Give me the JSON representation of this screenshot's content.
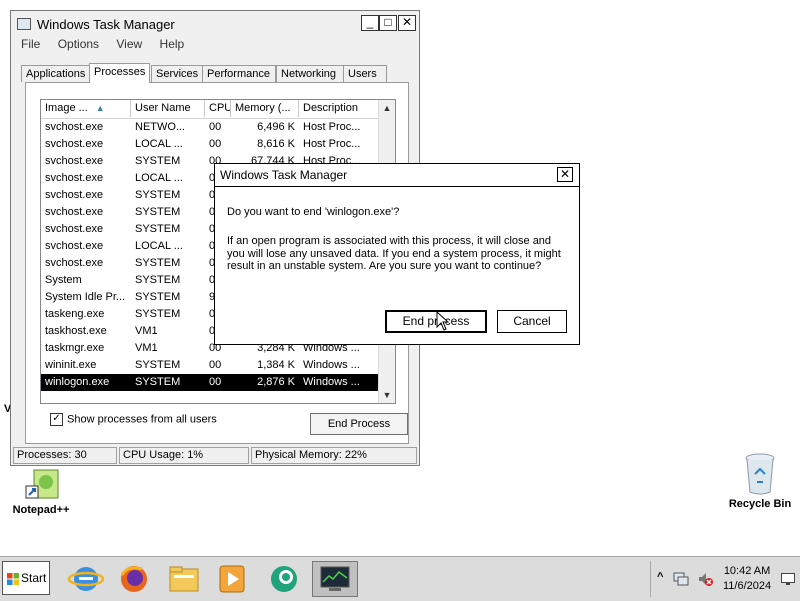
{
  "desktop": {
    "notepad_label": "Notepad++",
    "recycle_label": "Recycle Bin",
    "partial_label": "V"
  },
  "task_manager": {
    "title": "Windows Task Manager",
    "controls": {
      "minimize": "_",
      "maximize": "□",
      "close": "✕"
    },
    "menu": [
      "File",
      "Options",
      "View",
      "Help"
    ],
    "tabs": [
      "Applications",
      "Processes",
      "Services",
      "Performance",
      "Networking",
      "Users"
    ],
    "active_tab": "Processes",
    "columns": [
      "Image ...",
      "User Name",
      "CPU",
      "Memory (...",
      "Description"
    ],
    "processes": [
      {
        "image": "svchost.exe",
        "user": "NETWO...",
        "cpu": "00",
        "memory": "6,496 K",
        "desc": "Host Proc..."
      },
      {
        "image": "svchost.exe",
        "user": "LOCAL ...",
        "cpu": "00",
        "memory": "8,616 K",
        "desc": "Host Proc..."
      },
      {
        "image": "svchost.exe",
        "user": "SYSTEM",
        "cpu": "00",
        "memory": "67,744 K",
        "desc": "Host Proc..."
      },
      {
        "image": "svchost.exe",
        "user": "LOCAL ...",
        "cpu": "00",
        "memory": "",
        "desc": ""
      },
      {
        "image": "svchost.exe",
        "user": "SYSTEM",
        "cpu": "00",
        "memory": "",
        "desc": ""
      },
      {
        "image": "svchost.exe",
        "user": "SYSTEM",
        "cpu": "00",
        "memory": "",
        "desc": ""
      },
      {
        "image": "svchost.exe",
        "user": "SYSTEM",
        "cpu": "00",
        "memory": "",
        "desc": ""
      },
      {
        "image": "svchost.exe",
        "user": "LOCAL ...",
        "cpu": "00",
        "memory": "",
        "desc": ""
      },
      {
        "image": "svchost.exe",
        "user": "SYSTEM",
        "cpu": "00",
        "memory": "",
        "desc": ""
      },
      {
        "image": "System",
        "user": "SYSTEM",
        "cpu": "00",
        "memory": "",
        "desc": ""
      },
      {
        "image": "System Idle Pr...",
        "user": "SYSTEM",
        "cpu": "99",
        "memory": "",
        "desc": ""
      },
      {
        "image": "taskeng.exe",
        "user": "SYSTEM",
        "cpu": "00",
        "memory": "",
        "desc": ""
      },
      {
        "image": "taskhost.exe",
        "user": "VM1",
        "cpu": "00",
        "memory": "",
        "desc": ""
      },
      {
        "image": "taskmgr.exe",
        "user": "VM1",
        "cpu": "00",
        "memory": "3,284 K",
        "desc": "Windows ..."
      },
      {
        "image": "wininit.exe",
        "user": "SYSTEM",
        "cpu": "00",
        "memory": "1,384 K",
        "desc": "Windows ..."
      },
      {
        "image": "winlogon.exe",
        "user": "SYSTEM",
        "cpu": "00",
        "memory": "2,876 K",
        "desc": "Windows ..."
      }
    ],
    "selected_index": 15,
    "show_all_label": "Show processes from all users",
    "show_all_checked": "✓",
    "end_process_label": "End Process",
    "status": {
      "processes": "Processes: 30",
      "cpu": "CPU Usage: 1%",
      "memory": "Physical Memory: 22%"
    }
  },
  "dialog": {
    "title": "Windows Task Manager",
    "close": "✕",
    "question": "Do you want to end 'winlogon.exe'?",
    "message": "If an open program is associated with this process, it will close and you will lose any unsaved data. If you end a system process, it might result in an unstable system. Are you sure you want to continue?",
    "end_button": "End process",
    "cancel_button": "Cancel"
  },
  "taskbar": {
    "start_label": "Start",
    "apps": [
      "internet-explorer-icon",
      "firefox-icon",
      "file-explorer-icon",
      "media-player-icon",
      "app-icon",
      "task-manager-icon"
    ],
    "tray_expand": "^",
    "time": "10:42 AM",
    "date": "11/6/2024"
  }
}
